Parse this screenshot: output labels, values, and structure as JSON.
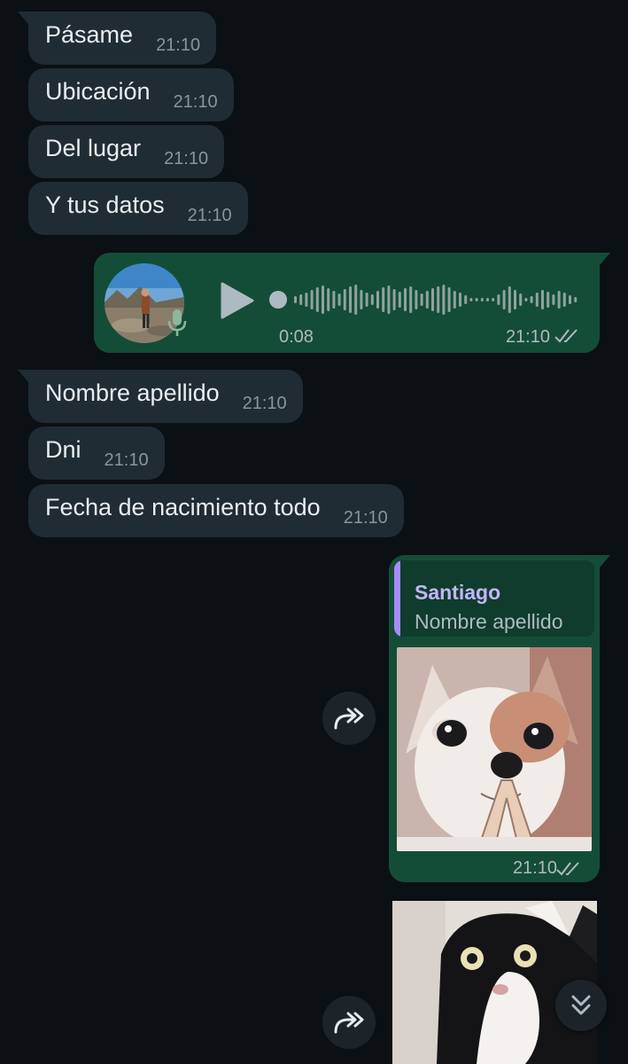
{
  "messages": {
    "m1": {
      "text": "Pásame",
      "time": "21:10"
    },
    "m2": {
      "text": "Ubicación",
      "time": "21:10"
    },
    "m3": {
      "text": "Del lugar",
      "time": "21:10"
    },
    "m4": {
      "text": "Y tus datos",
      "time": "21:10"
    },
    "m5": {
      "text": "Nombre apellido",
      "time": "21:10"
    },
    "m6": {
      "text": "Dni",
      "time": "21:10"
    },
    "m7": {
      "text": "Fecha de nacimiento todo",
      "time": "21:10"
    }
  },
  "voice_note": {
    "duration": "0:08",
    "time": "21:10",
    "status_icon": "double-check-icon"
  },
  "reply_media": {
    "quote_author": "Santiago",
    "quote_text": "Nombre apellido",
    "time": "21:10",
    "status_icon": "double-check-icon"
  },
  "icons": {
    "forward": "forward-icon",
    "scroll_down": "chevron-double-down-icon",
    "play": "play-icon",
    "mic": "microphone-icon"
  },
  "colors": {
    "background": "#0b1014",
    "incoming_bubble": "#202c33",
    "outgoing_bubble": "#144d37",
    "quote_accent": "#a78bfa"
  }
}
